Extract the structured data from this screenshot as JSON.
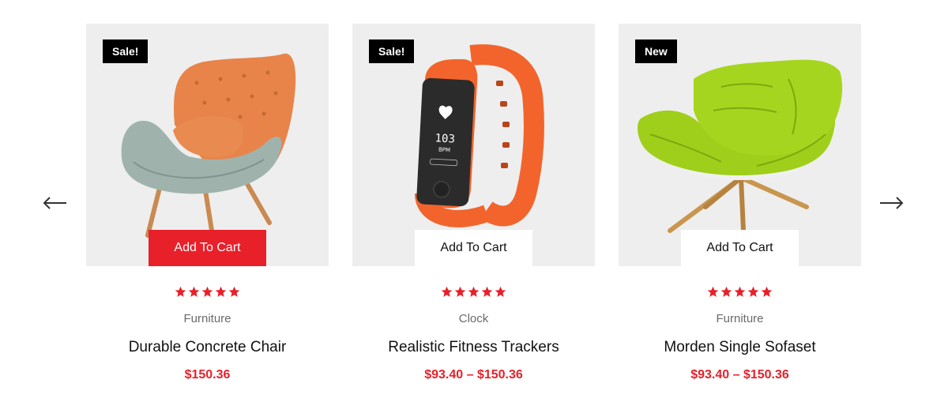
{
  "colors": {
    "accent": "#e8202a",
    "card_bg": "#eeeeee",
    "badge_bg": "#000000"
  },
  "carousel": {
    "prev_icon": "arrow-left-icon",
    "next_icon": "arrow-right-icon"
  },
  "products": [
    {
      "badge": "Sale!",
      "image_icon": "armchair-image",
      "cart_label": "Add To Cart",
      "cart_highlighted": true,
      "rating": 5,
      "category": "Furniture",
      "title": "Durable Concrete Chair",
      "price": "$150.36"
    },
    {
      "badge": "Sale!",
      "image_icon": "fitness-tracker-image",
      "screen_value": "103",
      "screen_unit": "BPM",
      "cart_label": "Add To Cart",
      "cart_highlighted": false,
      "rating": 5,
      "category": "Clock",
      "title": "Realistic Fitness Trackers",
      "price": "$93.40 – $150.36"
    },
    {
      "badge": "New",
      "image_icon": "green-chair-image",
      "cart_label": "Add To Cart",
      "cart_highlighted": false,
      "rating": 5,
      "category": "Furniture",
      "title": "Morden Single Sofaset",
      "price": "$93.40 – $150.36"
    }
  ]
}
